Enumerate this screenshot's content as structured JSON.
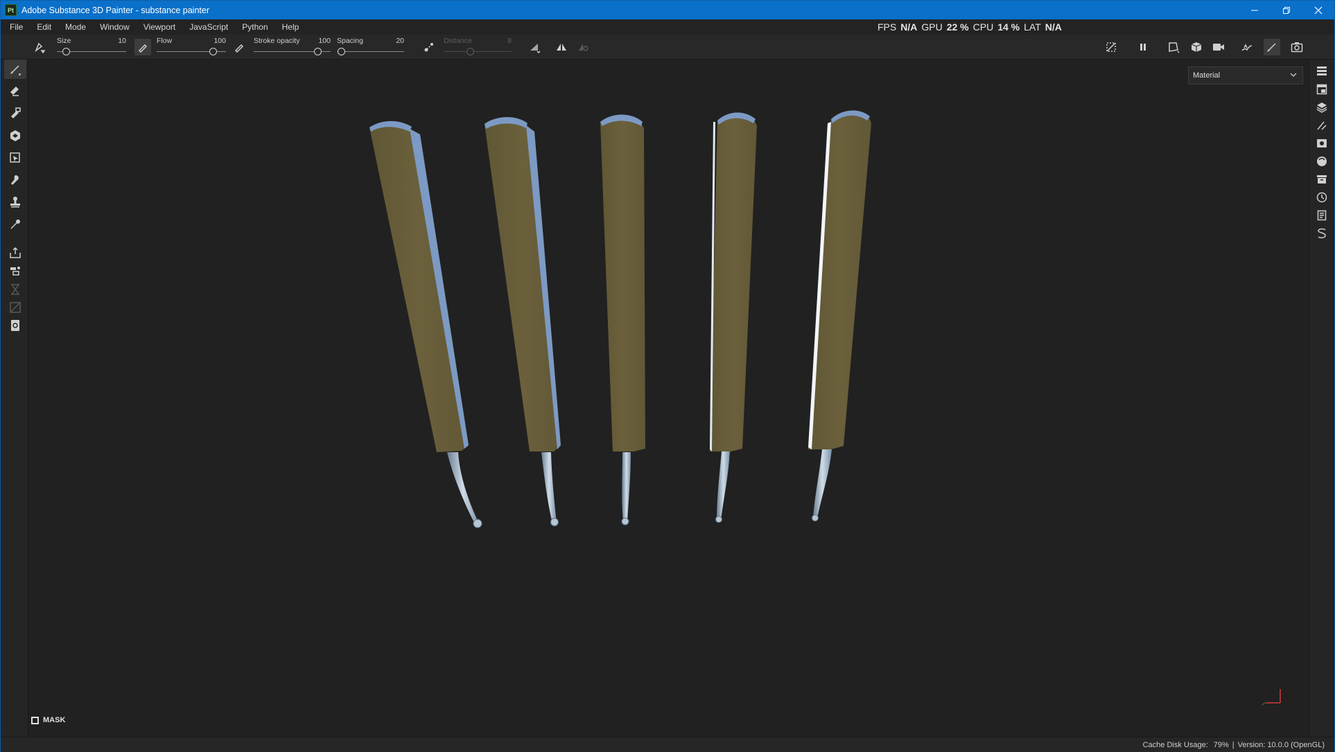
{
  "window": {
    "app_badge": "Pt",
    "title": "Adobe Substance 3D Painter - substance painter",
    "minimize_icon": "minimize-icon",
    "restore_icon": "restore-icon",
    "close_icon": "close-icon"
  },
  "menu": {
    "items": [
      "File",
      "Edit",
      "Mode",
      "Window",
      "Viewport",
      "JavaScript",
      "Python",
      "Help"
    ]
  },
  "performance": {
    "fps_label": "FPS",
    "fps_value": "N/A",
    "gpu_label": "GPU",
    "gpu_value": "22 %",
    "cpu_label": "CPU",
    "cpu_value": "14 %",
    "lat_label": "LAT",
    "lat_value": "N/A"
  },
  "tool_options": {
    "size": {
      "label": "Size",
      "value": "10",
      "level": 0.1
    },
    "flow": {
      "label": "Flow",
      "value": "100",
      "level": 1.0
    },
    "stroke_opacity": {
      "label": "Stroke opacity",
      "value": "100",
      "level": 1.0
    },
    "spacing": {
      "label": "Spacing",
      "value": "20",
      "level": 0.02
    },
    "distance": {
      "label": "Distance",
      "value": "8",
      "level": 0.45
    }
  },
  "viewport": {
    "channel_dropdown": "Material",
    "mask_label": "MASK"
  },
  "status": {
    "cache_label": "Cache Disk Usage:",
    "cache_value": "79%",
    "version": "Version: 10.0.0 (OpenGL)"
  },
  "colors": {
    "titlebar": "#0a70c9",
    "handle_wood": "#6b5f3c",
    "handle_edge": "#7c9ac4",
    "tip_metal": "#9fb4c8"
  }
}
